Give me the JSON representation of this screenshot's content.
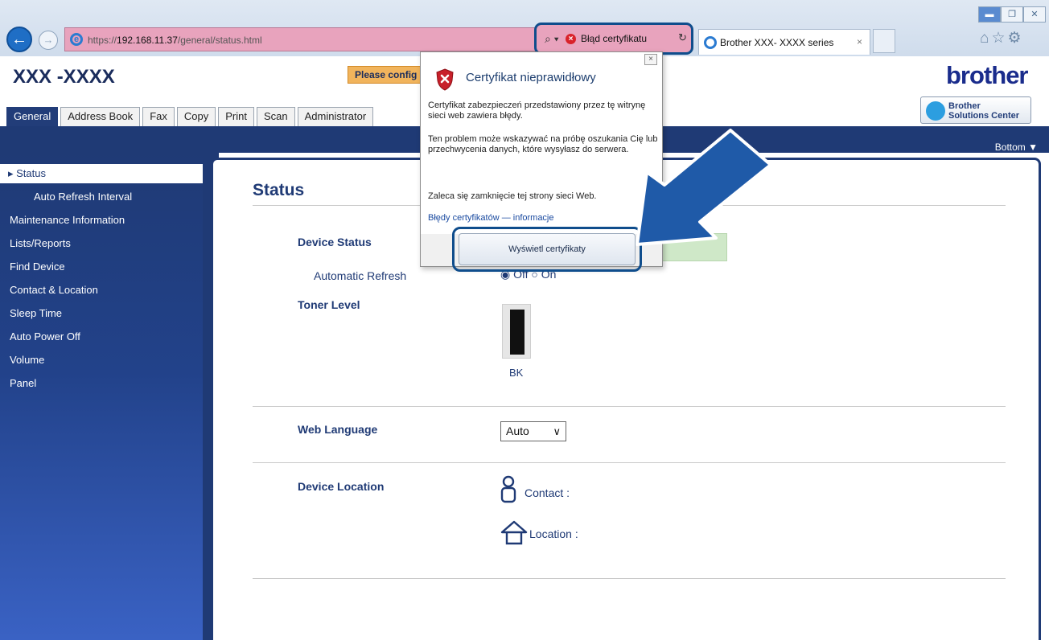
{
  "browser": {
    "url_prefix": "https://",
    "url_host": "192.168.11.37",
    "url_path": "/general/status.html",
    "cert_error_label": "Błąd certyfikatu",
    "tab_title": "Brother XXX- XXXX series"
  },
  "page": {
    "model": "XXX -XXXX",
    "please_label": "Please config",
    "brand": "brother",
    "solutions_line1": "Brother",
    "solutions_line2": "Solutions Center",
    "bottom_link": "Bottom ▼",
    "tabs": [
      "General",
      "Address Book",
      "Fax",
      "Copy",
      "Print",
      "Scan",
      "Administrator"
    ]
  },
  "sidebar": {
    "items": [
      "▸ Status",
      "Auto Refresh Interval",
      "Maintenance Information",
      "Lists/Reports",
      "Find Device",
      "Contact & Location",
      "Sleep Time",
      "Auto Power Off",
      "Volume",
      "Panel"
    ]
  },
  "main": {
    "heading": "Status",
    "device_status_label": "Device Status",
    "auto_refresh_label": "Automatic Refresh",
    "auto_refresh_value": "◉ Off  ○ On",
    "toner_label": "Toner Level",
    "toner_color": "BK",
    "toner_level": 1.0,
    "web_language_label": "Web Language",
    "web_language_value": "Auto",
    "device_location_label": "Device Location",
    "contact_label": "Contact :",
    "location_label": "Location :"
  },
  "popup": {
    "title": "Certyfikat nieprawidłowy",
    "p1": "Certyfikat zabezpieczeń przedstawiony przez tę witrynę sieci web zawiera błędy.",
    "p2": "Ten problem może wskazywać na próbę oszukania Cię lub przechwycenia danych, które wysyłasz do serwera.",
    "p3": "Zaleca się zamknięcie tej strony sieci Web.",
    "link": "Błędy certyfikatów — informacje",
    "button": "Wyświetl certyfikaty"
  },
  "colors": {
    "brand_blue": "#1f3a75",
    "cert_error_bg": "#e8a3bd",
    "highlight_outline": "#0f4d8c",
    "device_status_ok": "#cfe8c8"
  }
}
